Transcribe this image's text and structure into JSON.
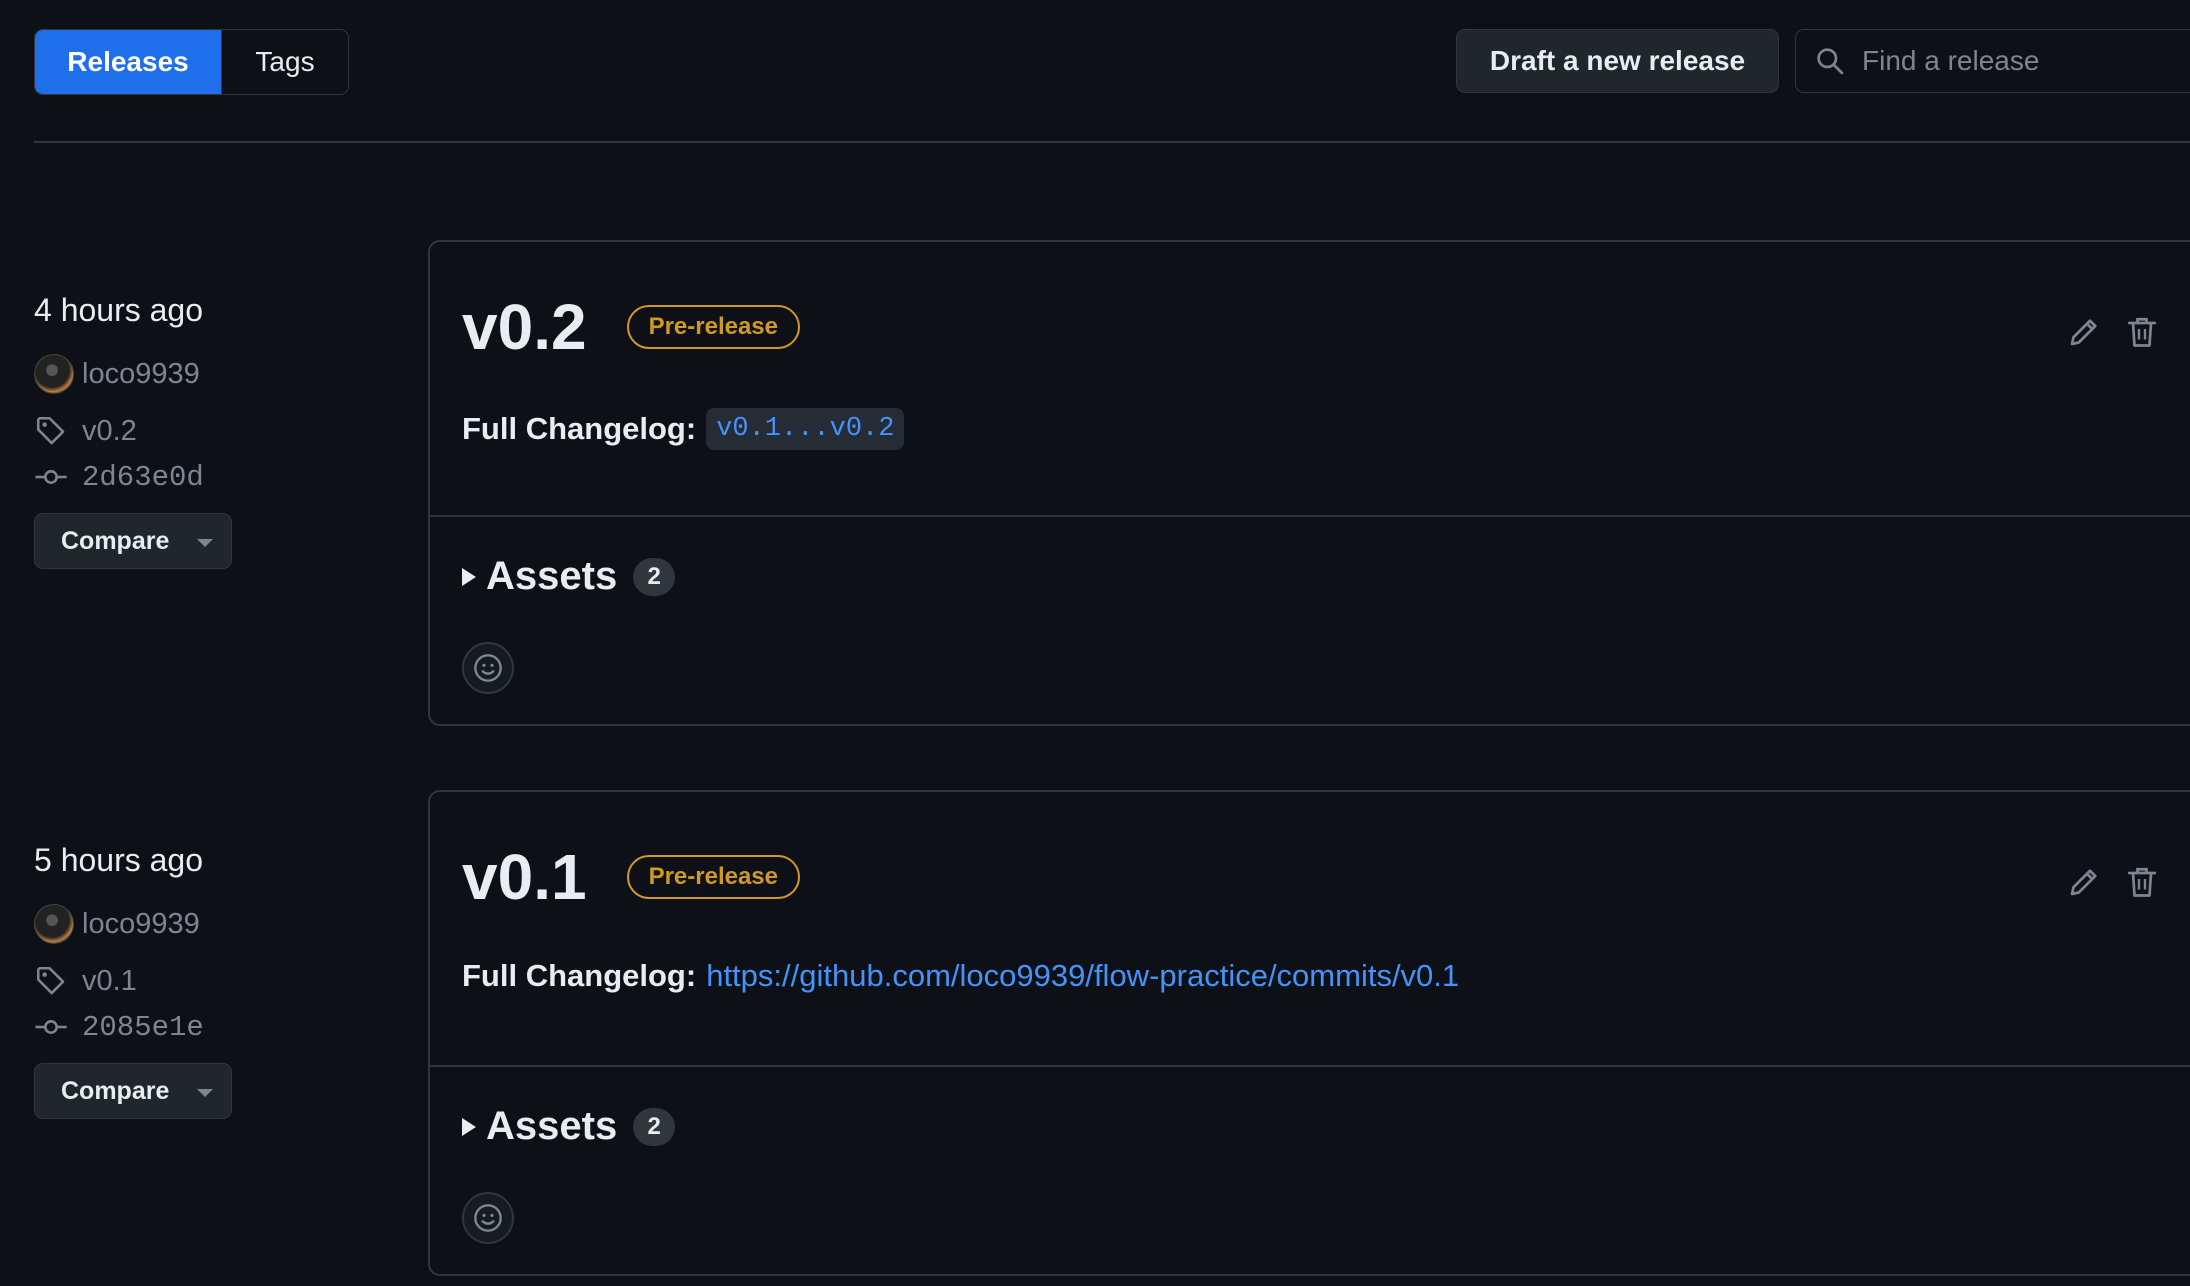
{
  "tabs": {
    "releases": "Releases",
    "tags": "Tags"
  },
  "toolbar": {
    "draft_label": "Draft a new release",
    "search_placeholder": "Find a release"
  },
  "releases": [
    {
      "time": "4 hours ago",
      "author": "loco9939",
      "tag": "v0.2",
      "commit": "2d63e0d",
      "compare_label": "Compare",
      "title": "v0.2",
      "badge": "Pre-release",
      "changelog_label": "Full Changelog:",
      "changelog_link": "v0.1...v0.2",
      "assets_label": "Assets",
      "assets_count": "2"
    },
    {
      "time": "5 hours ago",
      "author": "loco9939",
      "tag": "v0.1",
      "commit": "2085e1e",
      "compare_label": "Compare",
      "title": "v0.1",
      "badge": "Pre-release",
      "changelog_label": "Full Changelog:",
      "changelog_link": "https://github.com/loco9939/flow-practice/commits/v0.1",
      "assets_label": "Assets",
      "assets_count": "2"
    }
  ],
  "icons": {
    "search": "search-icon",
    "tag": "tag-icon",
    "commit": "commit-icon",
    "edit": "pencil-icon",
    "delete": "trash-icon",
    "reaction": "smiley-icon"
  },
  "colors": {
    "accent": "#1f6feb",
    "link": "#4493f8",
    "prerelease": "#d29922",
    "background": "#0d1117"
  }
}
